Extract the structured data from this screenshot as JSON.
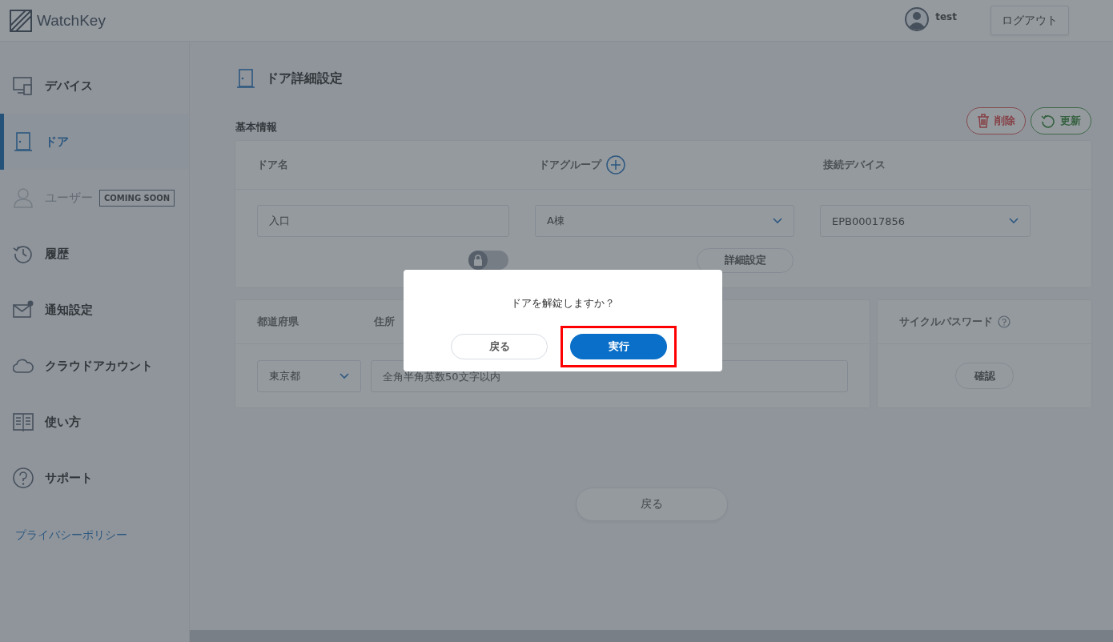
{
  "header": {
    "logo": "WatchKey",
    "user": "test",
    "logout": "ログアウト"
  },
  "sidebar": {
    "items": [
      {
        "label": "デバイス",
        "kind": "devices",
        "selected": false,
        "disabled": false
      },
      {
        "label": "ドア",
        "kind": "door",
        "selected": true,
        "disabled": false
      },
      {
        "label": "ユーザー",
        "kind": "user",
        "selected": false,
        "disabled": true,
        "badge": "COMING SOON"
      },
      {
        "label": "履歴",
        "kind": "history",
        "selected": false,
        "disabled": false
      },
      {
        "label": "通知設定",
        "kind": "mail",
        "selected": false,
        "disabled": false
      },
      {
        "label": "クラウドアカウント",
        "kind": "cloud",
        "selected": false,
        "disabled": false
      },
      {
        "label": "使い方",
        "kind": "book",
        "selected": false,
        "disabled": false
      },
      {
        "label": "サポート",
        "kind": "help",
        "selected": false,
        "disabled": false
      }
    ],
    "privacy_link": "プライバシーポリシー"
  },
  "page": {
    "title": "ドア詳細設定",
    "section": "基本情報",
    "actions": [
      {
        "label": "削除",
        "kind": "delete"
      },
      {
        "label": "更新",
        "kind": "refresh"
      }
    ],
    "basic": {
      "labels": {
        "name": "ドア名",
        "group": "ドアグループ",
        "device": "接続デバイス"
      },
      "name": "入口",
      "group": "A棟",
      "device": "EPB00017856",
      "lock_toggle": {
        "on": false
      },
      "detail_button": "詳細設定"
    },
    "address": {
      "labels": {
        "prefecture": "都道府県",
        "address": "住所"
      },
      "prefecture": "東京都",
      "address_placeholder": "全角半角英数50文字以内"
    },
    "cycle_password": {
      "title": "サイクルパスワード",
      "button": "確認"
    },
    "back_button": "戻る"
  },
  "dialog": {
    "message": "ドアを解錠しますか？",
    "buttons": [
      {
        "label": "戻る",
        "kind": "secondary",
        "highlighted": false
      },
      {
        "label": "実行",
        "kind": "primary",
        "highlighted": true
      }
    ]
  }
}
